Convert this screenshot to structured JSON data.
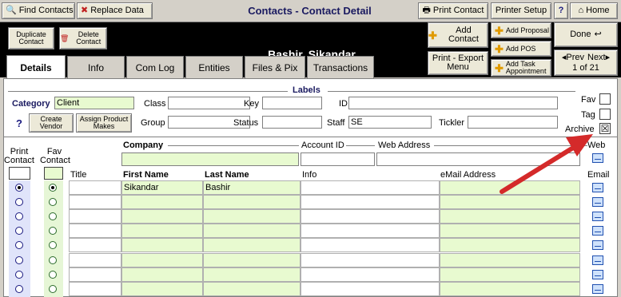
{
  "toolbar": {
    "find_contacts": "Find Contacts",
    "replace_data": "Replace Data",
    "title": "Contacts - Contact Detail",
    "print_contact": "Print Contact",
    "printer_setup": "Printer Setup",
    "help": "?",
    "home": "Home"
  },
  "header": {
    "contact_name": "Bashir, Sikandar",
    "duplicate_contact": "Duplicate Contact",
    "delete_contact": "Delete Contact",
    "add_contact": "Add Contact",
    "print_export_menu": "Print - Export Menu",
    "add_proposal": "Add Proposal",
    "add_pos": "Add POS",
    "add_task_appointment": "Add Task Appointment",
    "done": "Done",
    "prev": "Prev",
    "next": "Next",
    "record_position": "1 of 21"
  },
  "tabs": [
    "Details",
    "Info",
    "Com Log",
    "Entities",
    "Files & Pix",
    "Transactions"
  ],
  "labels_section": {
    "heading": "Labels",
    "category_label": "Category",
    "category_value": "Client",
    "class_label": "Class",
    "class_value": "",
    "key_label": "Key",
    "key_value": "",
    "id_label": "ID",
    "id_value": "",
    "group_label": "Group",
    "group_value": "",
    "status_label": "Status",
    "status_value": "",
    "staff_label": "Staff",
    "staff_value": "SE",
    "tickler_label": "Tickler",
    "tickler_value": "",
    "create_vendor": "Create Vendor",
    "assign_product_makes": "Assign Product Makes",
    "help": "?",
    "fav_label": "Fav",
    "tag_label": "Tag",
    "archive_label": "Archive",
    "archive_checked": "☒"
  },
  "company_section": {
    "print_contact_header": "Print Contact",
    "fav_contact_header": "Fav Contact",
    "company_label": "Company",
    "company_value": "",
    "account_id_label": "Account ID",
    "account_id_value": "",
    "web_address_label": "Web Address",
    "web_address_value": "",
    "web_label": "Web"
  },
  "contacts_table": {
    "columns": [
      "Title",
      "First Name",
      "Last Name",
      "Info",
      "eMail Address",
      "Email"
    ],
    "rows": [
      {
        "title": "",
        "first": "Sikandar",
        "last": "Bashir",
        "info": "",
        "email": "",
        "print": true,
        "fav": true
      },
      {
        "title": "",
        "first": "",
        "last": "",
        "info": "",
        "email": "",
        "print": false,
        "fav": false
      },
      {
        "title": "",
        "first": "",
        "last": "",
        "info": "",
        "email": "",
        "print": false,
        "fav": false
      },
      {
        "title": "",
        "first": "",
        "last": "",
        "info": "",
        "email": "",
        "print": false,
        "fav": false
      },
      {
        "title": "",
        "first": "",
        "last": "",
        "info": "",
        "email": "",
        "print": false,
        "fav": false
      },
      {
        "title": "",
        "first": "",
        "last": "",
        "info": "",
        "email": "",
        "print": false,
        "fav": false
      },
      {
        "title": "",
        "first": "",
        "last": "",
        "info": "",
        "email": "",
        "print": false,
        "fav": false
      },
      {
        "title": "",
        "first": "",
        "last": "",
        "info": "",
        "email": "",
        "print": false,
        "fav": false
      }
    ]
  },
  "colors": {
    "accent_green": "#e8fad0",
    "annotation_arrow": "#d42a2a",
    "header_black": "#000000"
  }
}
